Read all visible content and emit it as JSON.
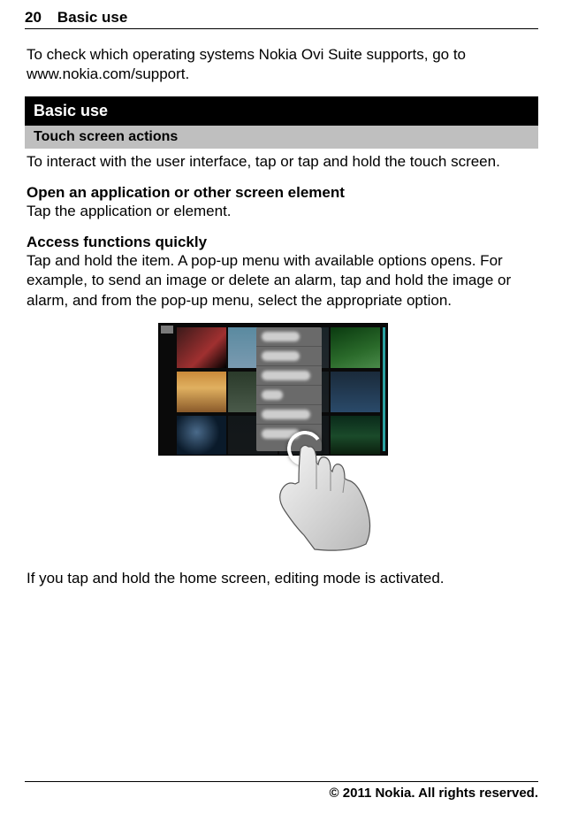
{
  "header": {
    "page_number": "20",
    "chapter": "Basic use"
  },
  "intro": "To check which operating systems Nokia Ovi Suite supports, go to www.nokia.com/support.",
  "section_title": "Basic use",
  "subsection_title": "Touch screen actions",
  "paragraphs": {
    "interact": "To interact with the user interface, tap or tap and hold the touch screen.",
    "open_head": "Open an application or other screen element",
    "open_body": "Tap the application or element.",
    "access_head": "Access functions quickly",
    "access_body": "Tap and hold the item. A pop-up menu with available options opens. For example, to send an image or delete an alarm, tap and hold the image or alarm, and from the pop-up menu, select the appropriate option.",
    "after_figure": "If you tap and hold the home screen, editing mode is activated."
  },
  "footer": "© 2011 Nokia. All rights reserved."
}
